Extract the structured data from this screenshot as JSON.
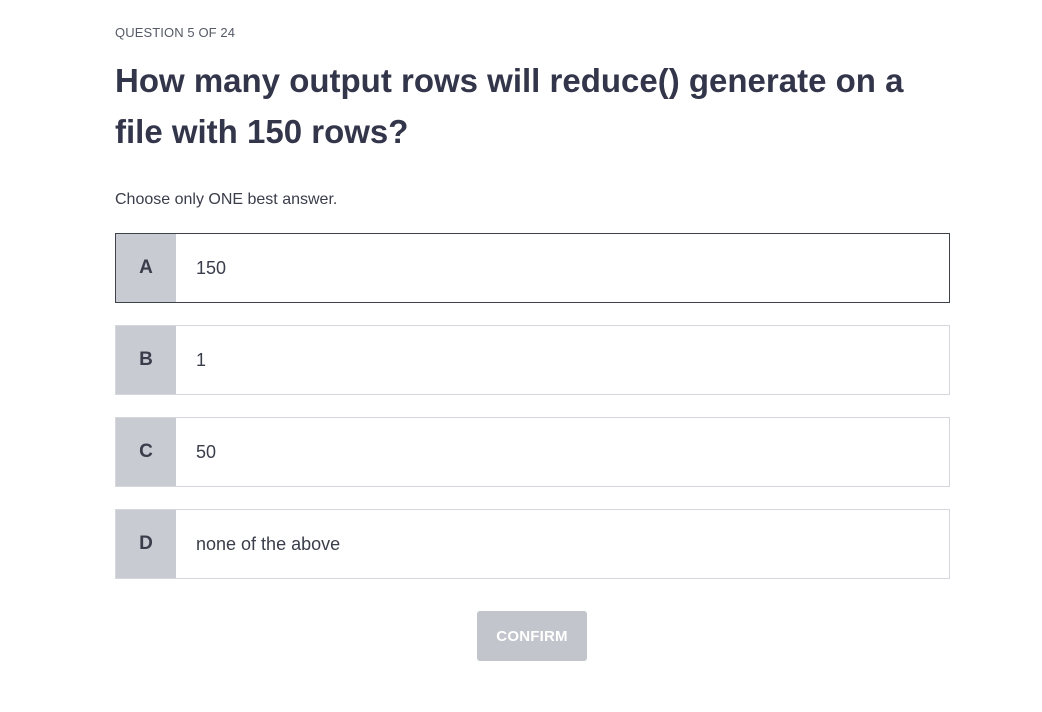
{
  "progress": "QUESTION 5 OF 24",
  "question": "How many output rows will reduce() generate on a file with 150 rows?",
  "instruction": "Choose only ONE best answer.",
  "options": [
    {
      "letter": "A",
      "text": "150",
      "selected": true
    },
    {
      "letter": "B",
      "text": "1",
      "selected": false
    },
    {
      "letter": "C",
      "text": "50",
      "selected": false
    },
    {
      "letter": "D",
      "text": "none of the above",
      "selected": false
    }
  ],
  "confirm_label": "CONFIRM",
  "confirm_enabled": false,
  "colors": {
    "letter_bg": "#c9cbd3",
    "selected_border": "#40424a",
    "option_border": "#d6d7dc",
    "confirm_disabled_bg": "#c3c5cc"
  }
}
